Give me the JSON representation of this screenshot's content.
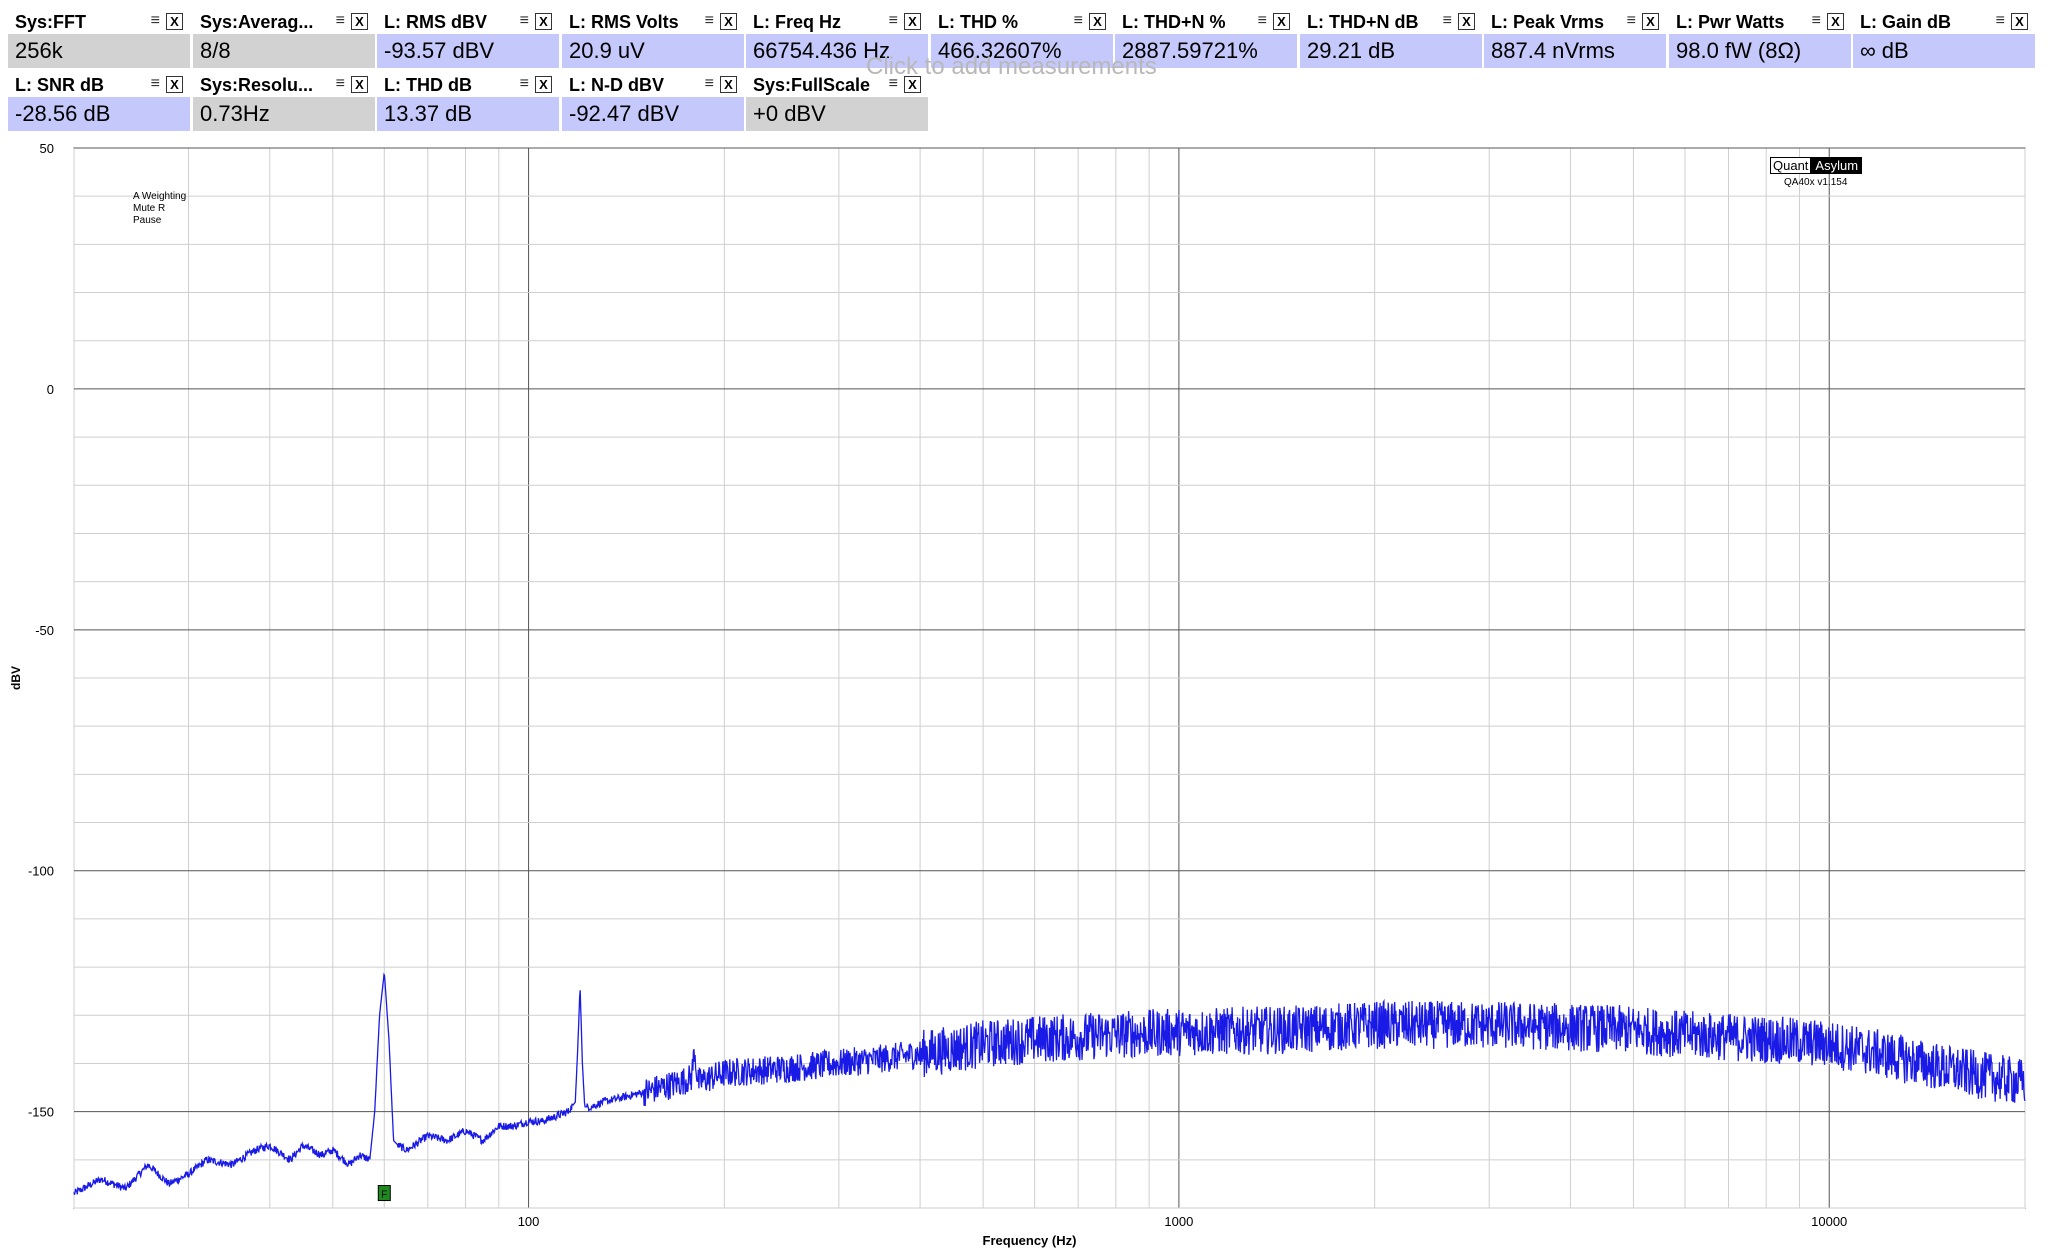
{
  "hint_text": "Click to add measurements",
  "tiles_row1": [
    {
      "title": "Sys:FFT",
      "value": "256k",
      "kind": "sys"
    },
    {
      "title": "Sys:Averag...",
      "value": "8/8",
      "kind": "sys"
    },
    {
      "title": "L: RMS dBV",
      "value": "-93.57 dBV",
      "kind": "ch"
    },
    {
      "title": "L: RMS Volts",
      "value": "20.9 uV",
      "kind": "ch"
    },
    {
      "title": "L: Freq Hz",
      "value": "66754.436 Hz",
      "kind": "ch"
    },
    {
      "title": "L: THD %",
      "value": "466.32607%",
      "kind": "ch"
    },
    {
      "title": "L: THD+N %",
      "value": "2887.59721%",
      "kind": "ch"
    },
    {
      "title": "L: THD+N dB",
      "value": "29.21 dB",
      "kind": "ch"
    },
    {
      "title": "L: Peak Vrms",
      "value": "887.4 nVrms",
      "kind": "ch"
    },
    {
      "title": "L: Pwr Watts",
      "value": "98.0 fW (8Ω)",
      "kind": "ch"
    },
    {
      "title": "L: Gain dB",
      "value": "∞ dB",
      "kind": "ch"
    }
  ],
  "tiles_row2": [
    {
      "title": "L: SNR dB",
      "value": "-28.56 dB",
      "kind": "ch"
    },
    {
      "title": "Sys:Resolu...",
      "value": "0.73Hz",
      "kind": "sys"
    },
    {
      "title": "L: THD dB",
      "value": "13.37 dB",
      "kind": "ch"
    },
    {
      "title": "L: N-D dBV",
      "value": "-92.47 dBV",
      "kind": "ch"
    },
    {
      "title": "Sys:FullScale",
      "value": "+0 dBV",
      "kind": "sys"
    }
  ],
  "tile_menu_glyph": "≡",
  "tile_close_glyph": "X",
  "annotations": [
    "A Weighting",
    "Mute R",
    "Pause"
  ],
  "brand": {
    "quant": "Quant",
    "asylum": "Asylum",
    "version": "QA40x v1.154"
  },
  "marker_label": "F",
  "chart_data": {
    "type": "line",
    "xlabel": "Frequency (Hz)",
    "ylabel": "dBV",
    "xscale": "log",
    "xlim": [
      20,
      20000
    ],
    "ylim": [
      -170,
      50
    ],
    "xticks": [
      100,
      1000,
      10000
    ],
    "xtick_labels": [
      "100",
      "1000",
      "10000"
    ],
    "yticks": [
      50,
      0,
      -50,
      -100,
      -150
    ],
    "ytick_labels": [
      "50",
      "0",
      "-50",
      "-100",
      "-150"
    ],
    "grid": true,
    "color": "#1a1ae6",
    "series": [
      {
        "x": [
          20,
          22,
          24,
          26,
          28,
          30,
          32,
          35,
          38,
          40,
          43,
          45,
          48,
          50,
          53,
          55,
          57,
          58,
          59,
          60,
          61,
          62,
          63,
          65,
          70,
          75,
          80,
          85,
          90,
          95,
          100,
          105,
          110,
          115,
          118,
          119,
          120,
          121,
          122,
          125,
          130,
          140,
          150,
          160,
          170,
          178,
          180,
          182,
          190,
          200,
          250,
          300,
          350,
          400,
          450,
          500,
          600,
          700,
          800,
          1000,
          1500,
          2000,
          3000,
          4000,
          5000,
          6000,
          8000,
          10000,
          12000,
          15000,
          18000,
          20000
        ],
        "y": [
          -167,
          -164,
          -166,
          -161,
          -165,
          -163,
          -160,
          -161,
          -158,
          -157,
          -160,
          -157,
          -159,
          -158,
          -161,
          -159,
          -160,
          -150,
          -130,
          -121,
          -135,
          -156,
          -157,
          -158,
          -155,
          -156,
          -154,
          -156,
          -153,
          -153,
          -152,
          -152,
          -151,
          -150,
          -148,
          -137,
          -124,
          -140,
          -149,
          -149,
          -148,
          -147,
          -146,
          -145,
          -144,
          -143,
          -137,
          -144,
          -143,
          -142,
          -141,
          -140,
          -139,
          -138,
          -137,
          -136,
          -135,
          -134.5,
          -134,
          -133.5,
          -133,
          -132,
          -132,
          -132.5,
          -133,
          -134,
          -135,
          -136,
          -138,
          -141,
          -143,
          -144
        ]
      }
    ],
    "markers": [
      {
        "x": 60,
        "y": -167
      }
    ]
  }
}
